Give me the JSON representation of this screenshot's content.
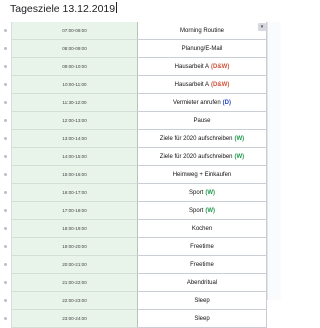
{
  "title": "Tagesziele 13.12.2019",
  "colors": {
    "time_cell_bg": "#e8f3e9",
    "tag_D": "#2a48c9",
    "tag_DW": "#d2543a",
    "tag_W": "#1f9a4d"
  },
  "rows": [
    {
      "time": "07:00-08:00",
      "task": "Morning Routine",
      "tag": "",
      "tag_color": ""
    },
    {
      "time": "08:00-09:00",
      "task": "Planung/E-Mail",
      "tag": "",
      "tag_color": ""
    },
    {
      "time": "09:00-10:00",
      "task": "Hausarbeit A",
      "tag": "(D&W)",
      "tag_color": "#d2543a"
    },
    {
      "time": "10:00-11:00",
      "task": "Hausarbeit A",
      "tag": "(D&W)",
      "tag_color": "#d2543a"
    },
    {
      "time": "11:30-12:00",
      "task": "Vermieter anrufen",
      "tag": "(D)",
      "tag_color": "#2a48c9"
    },
    {
      "time": "12:00-13:00",
      "task": "Pause",
      "tag": "",
      "tag_color": ""
    },
    {
      "time": "13:00-14:00",
      "task": "Ziele für 2020 aufschreiben",
      "tag": "(W)",
      "tag_color": "#1f9a4d"
    },
    {
      "time": "14:00-15:00",
      "task": "Ziele für 2020 aufschreiben",
      "tag": "(W)",
      "tag_color": "#1f9a4d"
    },
    {
      "time": "15:00-16:00",
      "task": "Heimweg + Einkaufen",
      "tag": "",
      "tag_color": ""
    },
    {
      "time": "16:00-17:00",
      "task": "Sport",
      "tag": "(W)",
      "tag_color": "#1f9a4d"
    },
    {
      "time": "17:00-18:00",
      "task": "Sport",
      "tag": "(W)",
      "tag_color": "#1f9a4d"
    },
    {
      "time": "18:00-19:00",
      "task": "Kochen",
      "tag": "",
      "tag_color": ""
    },
    {
      "time": "19:00-20:00",
      "task": "Freetime",
      "tag": "",
      "tag_color": ""
    },
    {
      "time": "20:00-21:00",
      "task": "Freetime",
      "tag": "",
      "tag_color": ""
    },
    {
      "time": "21:00-22:00",
      "task": "Abendritual",
      "tag": "",
      "tag_color": ""
    },
    {
      "time": "22:00-23:00",
      "task": "Sleep",
      "tag": "",
      "tag_color": ""
    },
    {
      "time": "23:00-24:00",
      "task": "Sleep",
      "tag": "",
      "tag_color": ""
    }
  ],
  "dropdown_icon": "chevron-down-icon"
}
